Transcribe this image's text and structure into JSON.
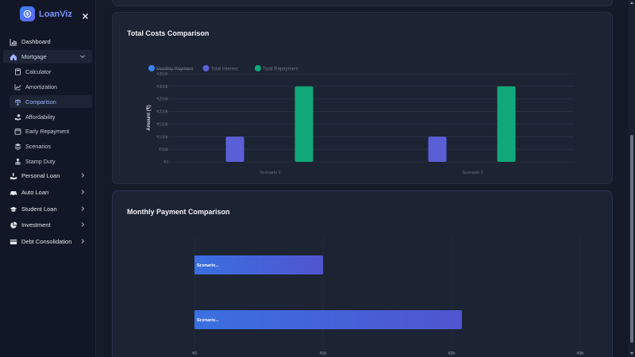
{
  "brand": {
    "name": "LoanViz"
  },
  "sidebar": {
    "items": [
      {
        "label": "Dashboard"
      },
      {
        "label": "Mortgage"
      },
      {
        "label": "Personal Loan"
      },
      {
        "label": "Auto Loan"
      },
      {
        "label": "Student Loan"
      },
      {
        "label": "Investment"
      },
      {
        "label": "Debt Consolidation"
      }
    ],
    "mortgage_sub": [
      {
        "label": "Calculator"
      },
      {
        "label": "Amortization"
      },
      {
        "label": "Comparison"
      },
      {
        "label": "Affordability"
      },
      {
        "label": "Early Repayment"
      },
      {
        "label": "Scenarios"
      },
      {
        "label": "Stamp Duty"
      }
    ]
  },
  "colors": {
    "accent": "#6366f1",
    "interest": "#5b5fd6",
    "repayment": "#10a878",
    "monthly": "#3b82f6"
  },
  "chart_data": [
    {
      "type": "bar",
      "title": "Total Costs Comparison",
      "ylabel": "Amount (₹)",
      "categories": [
        "Scenario 1",
        "Scenario 2"
      ],
      "y_ticks": [
        "₹0",
        "₹50K",
        "₹100K",
        "₹150K",
        "₹200K",
        "₹250K",
        "₹300K",
        "₹350K"
      ],
      "ylim": [
        0,
        350000
      ],
      "legend_position": "top-left",
      "series": [
        {
          "name": "Monthly Payment",
          "values": [
            0,
            0
          ],
          "hidden": true
        },
        {
          "name": "Total Interest",
          "values": [
            100000,
            100000
          ]
        },
        {
          "name": "Total Repayment",
          "values": [
            300000,
            300000
          ]
        }
      ]
    },
    {
      "type": "bar",
      "orientation": "horizontal",
      "title": "Monthly Payment Comparison",
      "categories": [
        "Scenario...",
        "Scenario..."
      ],
      "x_ticks": [
        "₹0",
        "₹1K",
        "₹2K",
        "₹3K"
      ],
      "xlim": [
        0,
        3000
      ],
      "series": [
        {
          "values": [
            1000,
            2080
          ]
        }
      ]
    }
  ]
}
